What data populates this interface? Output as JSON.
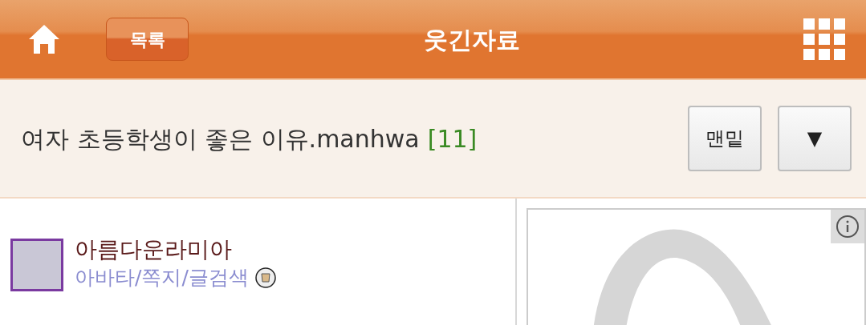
{
  "header": {
    "list_button": "목록",
    "title": "웃긴자료"
  },
  "post": {
    "title": "여자 초등학생이 좋은 이유.manhwa",
    "comment_count": "[11]",
    "buttons": [
      {
        "label": "맨밑"
      },
      {
        "label": "▼"
      }
    ]
  },
  "author": {
    "name": "아름다운라미아",
    "links": "아바타/쪽지/글검색"
  }
}
